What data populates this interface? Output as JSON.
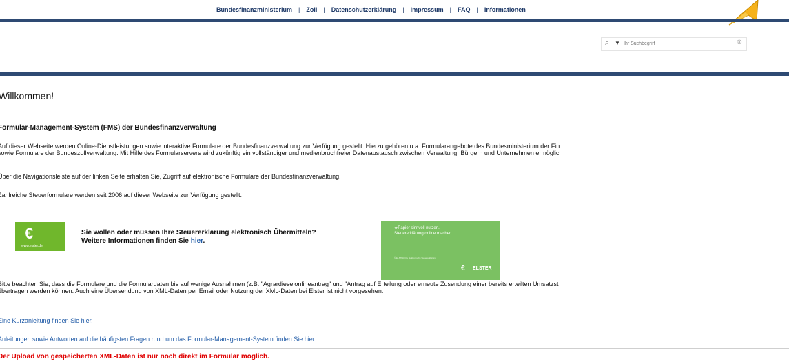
{
  "topnav": {
    "links": [
      "Bundesfinanzministerium",
      "Zoll",
      "Datenschutzerklärung",
      "Impressum",
      "FAQ",
      "Informationen"
    ],
    "separator": "|"
  },
  "search": {
    "placeholder": "Ihr Suchbegriff",
    "icon": "search-icon",
    "dropdown_icon": "chevron-down-icon",
    "clear_icon": "clear-icon"
  },
  "main": {
    "welcome": "Willkommen!",
    "subheading": "Formular-Management-System (FMS) der Bundesfinanzverwaltung",
    "intro_line1": "Auf dieser Webseite werden Online-Dienstleistungen sowie interaktive Formulare der Bundesfinanzverwaltung zur Verfügung gestellt. Hierzu gehören u.a. Formularangebote des Bundesministerium der Fin",
    "intro_line2": "sowie Formulare der Bundeszollverwaltung. Mit Hilfe des Formularservers wird zukünftig ein vollständiger und medienbruchfreier Datenaustausch zwischen Verwaltung, Bürgern und Unternehmen ermöglic",
    "navigation_text": "Über die Navigationsleiste auf der linken Seite erhalten Sie, Zugriff auf elektronische Formulare der Bundesfinanzverwaltung.",
    "tax_forms_text": "Zahlreiche Steuerformulare werden seit 2006 auf dieser Webseite zur Verfügung gestellt.",
    "elster": {
      "logo_domain": "www.elster.de",
      "text_line1": "Sie wollen oder müssen Ihre Steuererklärung elektronisch Übermitteln?",
      "text_line2_prefix": "Weitere Informationen finden Sie ",
      "text_line2_link": "hier",
      "text_line2_suffix": ".",
      "banner_line1": "★Papier sinnvoll nutzen.",
      "banner_line2": "Steuererklärung online machen.",
      "banner_small": "© ELSTER  Die elektronische Steuererklärung",
      "banner_brand": "ELSTER"
    },
    "notice_line1": "Bitte beachten Sie, dass die Formulare und die Formulardaten bis auf wenige Ausnahmen (z.B. \"Agrardieselonlineantrag\" und \"Antrag auf Erteilung oder erneute Zusendung einer bereits erteilten Umsatzst",
    "notice_line2": "übertragen werden können. Auch eine Übersendung von XML-Daten per Email oder Nutzung der XML-Daten bei Elster ist nicht vorgesehen.",
    "guide_text": "Eine Kurzanleitung finden Sie hier.",
    "faq_text": "Anleitungen sowie Antworten auf die häufigsten Fragen rund um das Formular-Management-System finden Sie hier.",
    "upload_notice": "Der Upload von gespeicherten XML-Daten ist nur noch direkt im Formular möglich."
  },
  "colors": {
    "header_bar": "#2e4a73",
    "link": "#1f5aa6",
    "elster_green": "#70b72c",
    "notice_red": "#e00000",
    "cursor": "#f6b21a"
  }
}
